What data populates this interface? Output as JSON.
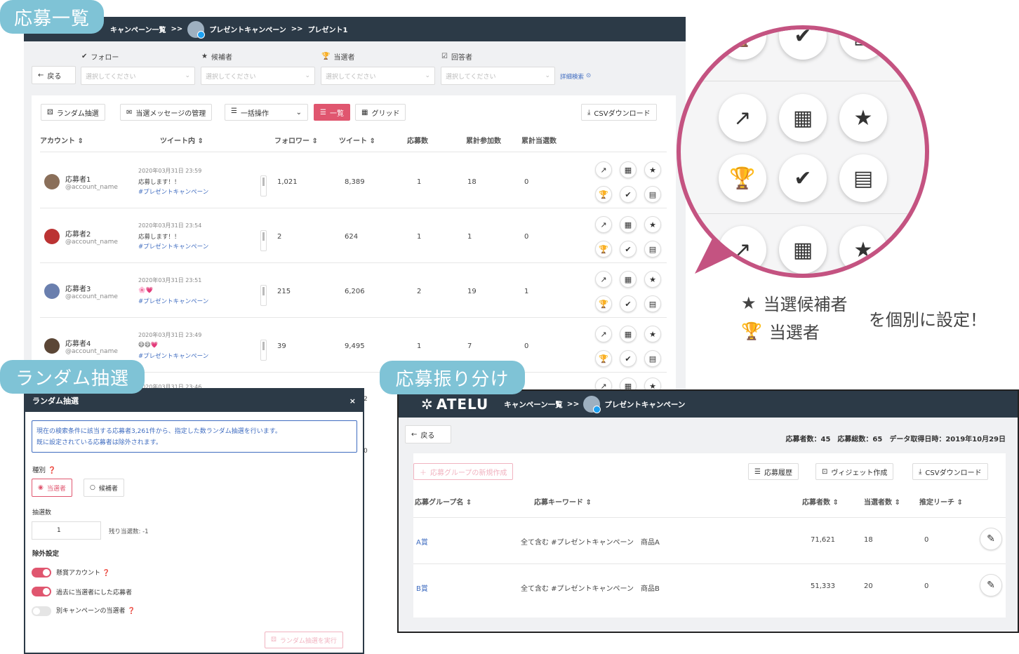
{
  "labels": {
    "entries": "応募一覧",
    "random": "ランダム抽選",
    "distribution": "応募振り分け"
  },
  "colors": {
    "navy": "#2c3a47",
    "pink": "#e0566f",
    "magenta": "#c45381",
    "label_blue": "#7fc3d6",
    "link_blue": "#3f6cc0"
  },
  "main": {
    "breadcrumb": [
      "キャンペーン一覧",
      ">>",
      "プレゼントキャンペーン",
      ">>",
      "プレゼント1"
    ],
    "back": "戻る",
    "filters": [
      {
        "label": "フォロー",
        "icon": "check-circle-icon",
        "placeholder": "選択してください"
      },
      {
        "label": "候補者",
        "icon": "star-icon",
        "placeholder": "選択してください"
      },
      {
        "label": "当選者",
        "icon": "trophy-icon",
        "placeholder": "選択してください"
      },
      {
        "label": "回答者",
        "icon": "checkbox-icon",
        "placeholder": "選択してください"
      }
    ],
    "advanced": "詳細検索",
    "toolbar": {
      "random": "ランダム抽選",
      "messages": "当選メッセージの管理",
      "bulk": "一括操作",
      "list": "一覧",
      "grid": "グリッド",
      "csv": "CSVダウンロード"
    },
    "columns": [
      "アカウント",
      "ツイート内",
      "フォロワー",
      "ツイート",
      "応募数",
      "累計参加数",
      "累計当選数"
    ],
    "rows": [
      {
        "name": "応募者1",
        "account": "@account_name",
        "date": "2020年03月31日 23:59",
        "text": "応募します！！",
        "tag": "#プレゼントキャンペーン",
        "followers": "1,021",
        "tweets": "8,389",
        "entries": "1",
        "total": "18",
        "wins": "0"
      },
      {
        "name": "応募者2",
        "account": "@account_name",
        "date": "2020年03月31日 23:54",
        "text": "応募します！！",
        "tag": "#プレゼントキャンペーン",
        "followers": "2",
        "tweets": "624",
        "entries": "1",
        "total": "1",
        "wins": "0"
      },
      {
        "name": "応募者3",
        "account": "@account_name",
        "date": "2020年03月31日 23:51",
        "text": "🌸💗",
        "tag": "#プレゼントキャンペーン",
        "followers": "215",
        "tweets": "6,206",
        "entries": "2",
        "total": "19",
        "wins": "1"
      },
      {
        "name": "応募者4",
        "account": "@account_name",
        "date": "2020年03月31日 23:49",
        "text": "😄😄💗",
        "tag": "#プレゼントキャンペーン",
        "followers": "39",
        "tweets": "9,495",
        "entries": "1",
        "total": "7",
        "wins": "0"
      }
    ],
    "partial_date": "2020年03月31日 23:46",
    "partial_a": "2",
    "partial_b": "0"
  },
  "legend": {
    "candidate": "当選候補者",
    "winner": "当選者",
    "note": "を個別に設定！"
  },
  "random_modal": {
    "title": "ランダム抽選",
    "info_1": "現在の検索条件に該当する応募者3,261件から、指定した数ランダム抽選を行います。",
    "info_2": "既に設定されている応募者は除外されます。",
    "type_label": "種別",
    "opt_winner": "当選者",
    "opt_candidate": "候補者",
    "count_label": "抽選数",
    "count_value": "1",
    "remaining": "残り当選数: -1",
    "exclude_label": "除外設定",
    "toggles": [
      {
        "label": "懸賞アカウント",
        "on": true
      },
      {
        "label": "過去に当選者にした応募者",
        "on": true
      },
      {
        "label": "別キャンペーンの当選者",
        "on": false
      }
    ],
    "run": "ランダム抽選を実行"
  },
  "distribution": {
    "logo": "ATELU",
    "crumb_1": "キャンペーン一覧",
    "crumb_sep": ">>",
    "crumb_2": "プレゼントキャンペーン",
    "back": "戻る",
    "stats": "応募者数：45　応募総数：65　データ取得日時：2019年10月29日",
    "new_group": "応募グループの新規作成",
    "history": "応募履歴",
    "widget": "ヴィジェット作成",
    "csv": "CSVダウンロード",
    "columns": [
      "応募グループ名",
      "応募キーワード",
      "応募者数",
      "当選者数",
      "推定リーチ"
    ],
    "rows": [
      {
        "name": "A賞",
        "keyword": "全て含む #プレゼントキャンペーン　商品A",
        "applicants": "71,621",
        "winners": "18",
        "reach": "0"
      },
      {
        "name": "B賞",
        "keyword": "全て含む #プレゼントキャンペーン　商品B",
        "applicants": "51,333",
        "winners": "20",
        "reach": "0"
      }
    ]
  }
}
